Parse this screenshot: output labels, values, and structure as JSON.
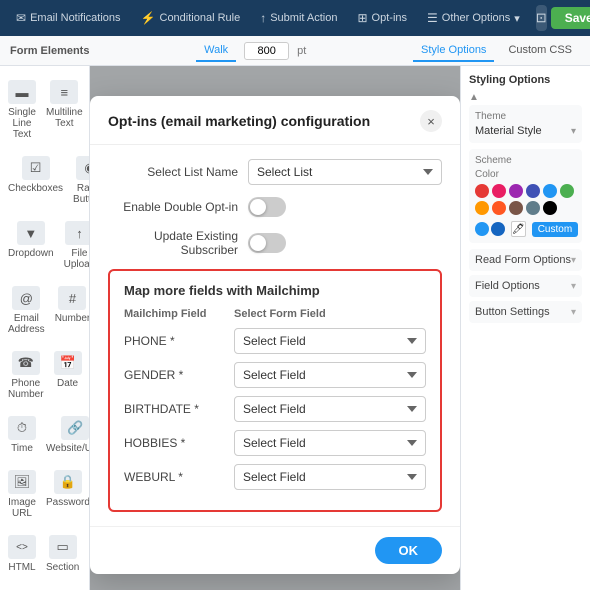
{
  "topnav": {
    "items": [
      {
        "id": "email-notif",
        "label": "Email Notifications",
        "icon": "✉"
      },
      {
        "id": "conditional-rule",
        "label": "Conditional Rule",
        "icon": "⚡"
      },
      {
        "id": "submit-action",
        "label": "Submit Action",
        "icon": "↑"
      },
      {
        "id": "opt-ins",
        "label": "Opt-ins",
        "icon": "⊞"
      },
      {
        "id": "other-options",
        "label": "Other Options",
        "icon": "☰"
      }
    ],
    "save_label": "Save"
  },
  "subnav": {
    "left_label": "Form Elements",
    "tabs": [
      "Walk"
    ],
    "active_tab": "Walk",
    "width_value": "800",
    "width_unit": "pt",
    "right_tabs": [
      "Style Options",
      "Custom CSS"
    ],
    "active_right_tab": "Style Options"
  },
  "sidebar": {
    "items": [
      {
        "id": "single-line-text",
        "label": "Single Line Text",
        "icon": "▬"
      },
      {
        "id": "multiline-text",
        "label": "Multiline Text",
        "icon": "▬▬"
      },
      {
        "id": "checkboxes",
        "label": "Checkboxes",
        "icon": "☑"
      },
      {
        "id": "radio-buttons",
        "label": "Radio Buttons",
        "icon": "◉"
      },
      {
        "id": "dropdown",
        "label": "Dropdown",
        "icon": "▼"
      },
      {
        "id": "file-upload",
        "label": "File Upload",
        "icon": "↑"
      },
      {
        "id": "email-address",
        "label": "Email Address",
        "icon": "@"
      },
      {
        "id": "number",
        "label": "Number",
        "icon": "#"
      },
      {
        "id": "phone-number",
        "label": "Phone Number",
        "icon": "☎"
      },
      {
        "id": "date",
        "label": "Date",
        "icon": "📅"
      },
      {
        "id": "time",
        "label": "Time",
        "icon": "⏱"
      },
      {
        "id": "website-url",
        "label": "Website/URL",
        "icon": "🔗"
      },
      {
        "id": "image-url",
        "label": "Image URL",
        "icon": "🖼"
      },
      {
        "id": "password",
        "label": "Password",
        "icon": "🔒"
      },
      {
        "id": "html",
        "label": "HTML",
        "icon": "<>"
      },
      {
        "id": "section",
        "label": "Section",
        "icon": "▭"
      }
    ]
  },
  "right_sidebar": {
    "title": "Styling Options",
    "theme_label": "Theme",
    "theme_value": "Material Style",
    "scheme_label": "Scheme",
    "color_label": "Color",
    "colors": [
      "#e53935",
      "#e91e63",
      "#9c27b0",
      "#3f51b5",
      "#2196f3",
      "#4caf50",
      "#ff9800",
      "#ff5722",
      "#795548",
      "#607d8b",
      "#000000"
    ],
    "custom_label": "Custom",
    "options": [
      {
        "id": "read-form-options",
        "label": "Read Form Options"
      },
      {
        "id": "field-options",
        "label": "Field Options"
      },
      {
        "id": "button-settings",
        "label": "Button Settings"
      }
    ]
  },
  "modal": {
    "title": "Opt-ins (email marketing) configuration",
    "close_label": "×",
    "list_name_label": "Select List Name",
    "list_name_placeholder": "Select List",
    "double_optin_label": "Enable Double Opt-in",
    "update_subscriber_label": "Update Existing Subscriber",
    "map_fields_title": "Map more fields with Mailchimp",
    "col1_label": "Mailchimp Field",
    "col2_label": "Select Form Field",
    "fields": [
      {
        "id": "phone",
        "name": "PHONE *",
        "select_label": "Select Field"
      },
      {
        "id": "gender",
        "name": "GENDER *",
        "select_label": "Select Field"
      },
      {
        "id": "birthdate",
        "name": "BIRTHDATE *",
        "select_label": "Select Field"
      },
      {
        "id": "hobbies",
        "name": "HOBBIES *",
        "select_label": "Select Field"
      },
      {
        "id": "weburl",
        "name": "WEBURL *",
        "select_label": "Select Field"
      }
    ],
    "ok_label": "OK"
  }
}
